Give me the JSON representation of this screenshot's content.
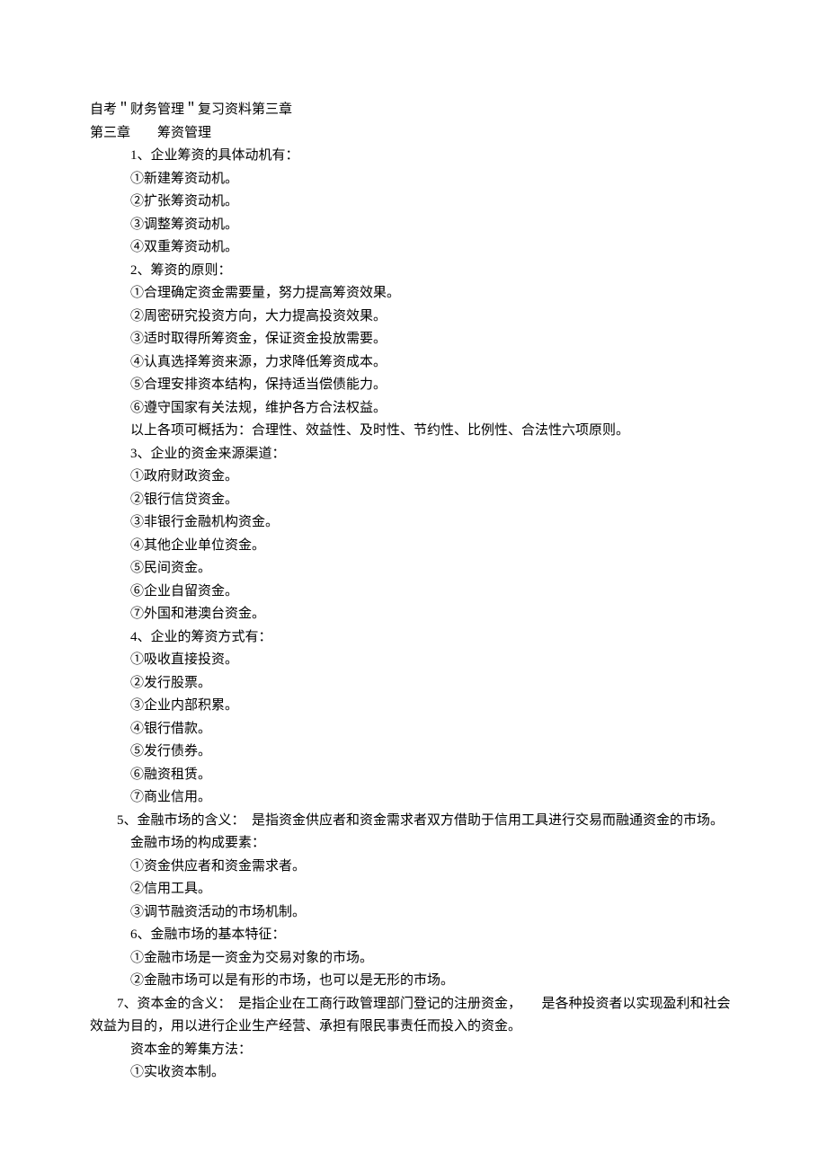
{
  "doc": {
    "title": "自考＂财务管理＂复习资料第三章",
    "chapter": "第三章　　筹资管理",
    "s1": {
      "head": "1、企业筹资的具体动机有：",
      "i1": "①新建筹资动机。",
      "i2": "②扩张筹资动机。",
      "i3": "③调整筹资动机。",
      "i4": "④双重筹资动机。"
    },
    "s2": {
      "head": "2、筹资的原则：",
      "i1": "①合理确定资金需要量，努力提高筹资效果。",
      "i2": "②周密研究投资方向，大力提高投资效果。",
      "i3": "③适时取得所筹资金，保证资金投放需要。",
      "i4": "④认真选择筹资来源，力求降低筹资成本。",
      "i5": "⑤合理安排资本结构，保持适当偿债能力。",
      "i6": "⑥遵守国家有关法规，维护各方合法权益。",
      "summary": "以上各项可概括为：合理性、效益性、及时性、节约性、比例性、合法性六项原则。"
    },
    "s3": {
      "head": "3、企业的资金来源渠道：",
      "i1": "①政府财政资金。",
      "i2": "②银行信贷资金。",
      "i3": "③非银行金融机构资金。",
      "i4": "④其他企业单位资金。",
      "i5": "⑤民间资金。",
      "i6": "⑥企业自留资金。",
      "i7": "⑦外国和港澳台资金。"
    },
    "s4": {
      "head": "4、企业的筹资方式有：",
      "i1": "①吸收直接投资。",
      "i2": "②发行股票。",
      "i3": "③企业内部积累。",
      "i4": "④银行借款。",
      "i5": "⑤发行债券。",
      "i6": "⑥融资租赁。",
      "i7": "⑦商业信用。"
    },
    "s5": {
      "head": "　　5、金融市场的含义：　是指资金供应者和资金需求者双方借助于信用工具进行交易而融通资金的市场。",
      "sub": "金融市场的构成要素：",
      "i1": "①资金供应者和资金需求者。",
      "i2": "②信用工具。",
      "i3": "③调节融资活动的市场机制。"
    },
    "s6": {
      "head": "6、金融市场的基本特征：",
      "i1": "①金融市场是一资金为交易对象的市场。",
      "i2": "②金融市场可以是有形的市场，也可以是无形的市场。"
    },
    "s7": {
      "head": "　　7、资本金的含义：　是指企业在工商行政管理部门登记的注册资金，　　是各种投资者以实现盈利和社会效益为目的，用以进行企业生产经营、承担有限民事责任而投入的资金。",
      "sub": "资本金的筹集方法：",
      "i1": "①实收资本制。"
    }
  }
}
